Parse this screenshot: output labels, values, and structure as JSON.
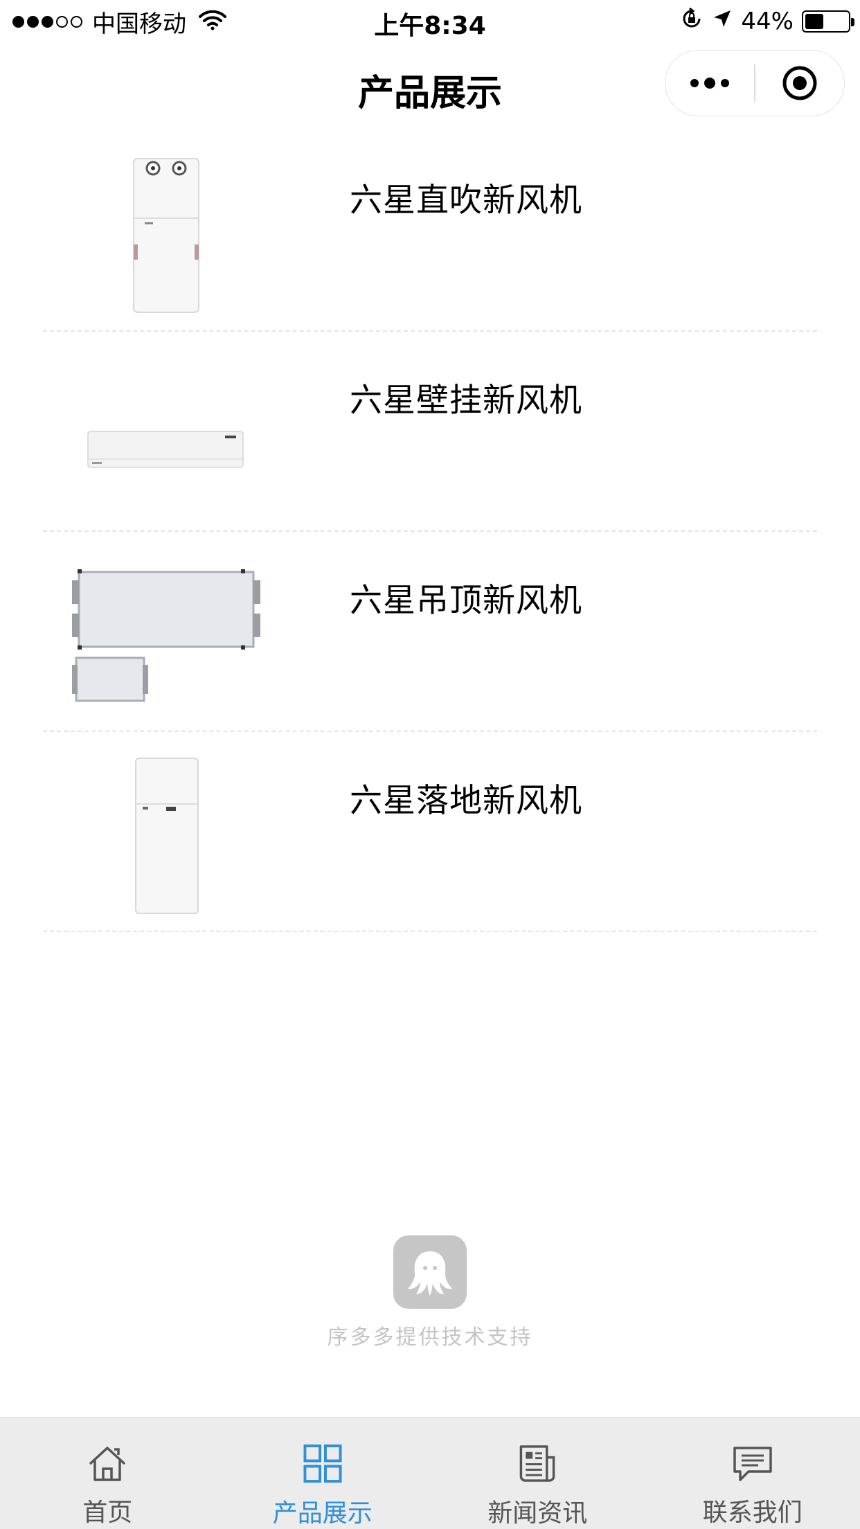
{
  "status_bar": {
    "signal_dots_filled": 3,
    "signal_dots_total": 5,
    "carrier": "中国移动",
    "time": "上午8:34",
    "battery_text": "44%",
    "battery_level": 0.44
  },
  "nav": {
    "title": "产品展示"
  },
  "products": [
    {
      "name": "六星直吹新风机",
      "image": "upright-air-unit"
    },
    {
      "name": "六星壁挂新风机",
      "image": "wall-mounted-air-unit"
    },
    {
      "name": "六星吊顶新风机",
      "image": "ceiling-air-unit"
    },
    {
      "name": "六星落地新风机",
      "image": "floor-standing-air-unit"
    }
  ],
  "support": {
    "text": "序多多提供技术支持",
    "logo_icon": "octopus-logo-icon"
  },
  "tabs": [
    {
      "label": "首页",
      "icon": "home-icon",
      "active": false
    },
    {
      "label": "产品展示",
      "icon": "grid-icon",
      "active": true
    },
    {
      "label": "新闻资讯",
      "icon": "news-icon",
      "active": false
    },
    {
      "label": "联系我们",
      "icon": "message-icon",
      "active": false
    }
  ],
  "colors": {
    "tab_active": "#2f8fd8",
    "tab_inactive": "#555555",
    "tab_bar_bg": "#ececec"
  }
}
